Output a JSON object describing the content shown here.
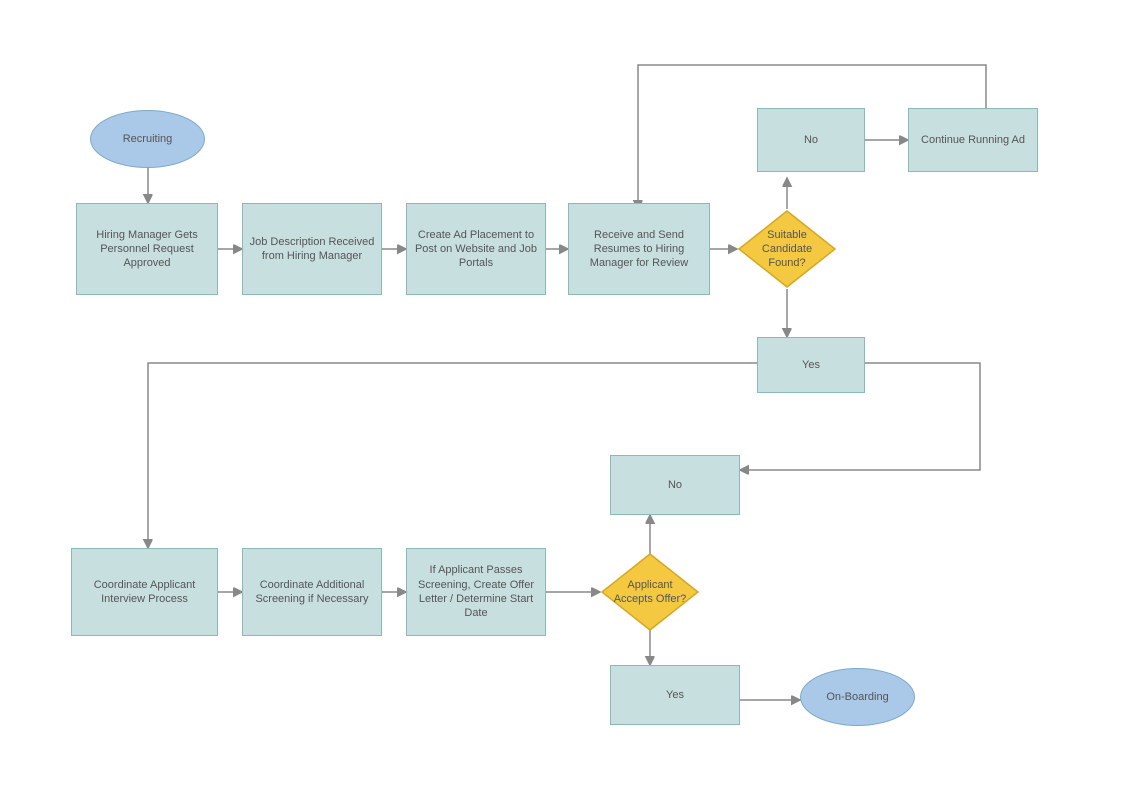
{
  "nodes": {
    "recruiting": {
      "label": "Recruiting"
    },
    "hiring_manager": {
      "label": "Hiring Manager Gets Personnel Request Approved"
    },
    "job_description": {
      "label": "Job Description Received from Hiring Manager"
    },
    "create_ad": {
      "label": "Create Ad Placement to Post on Website and Job Portals"
    },
    "receive_send": {
      "label": "Receive and Send Resumes to Hiring Manager for Review"
    },
    "suitable_candidate": {
      "label": "Suitable Candidate Found?"
    },
    "no_top": {
      "label": "No"
    },
    "continue_running": {
      "label": "Continue Running Ad"
    },
    "yes_right": {
      "label": "Yes"
    },
    "no_bottom": {
      "label": "No"
    },
    "coord_interview": {
      "label": "Coordinate Applicant Interview Process"
    },
    "coord_screening": {
      "label": "Coordinate Additional Screening if Necessary"
    },
    "if_applicant": {
      "label": "If Applicant Passes Screening, Create Offer Letter / Determine Start Date"
    },
    "applicant_accepts": {
      "label": "Applicant Accepts Offer?"
    },
    "yes_bottom": {
      "label": "Yes"
    },
    "onboarding": {
      "label": "On-Boarding"
    }
  }
}
